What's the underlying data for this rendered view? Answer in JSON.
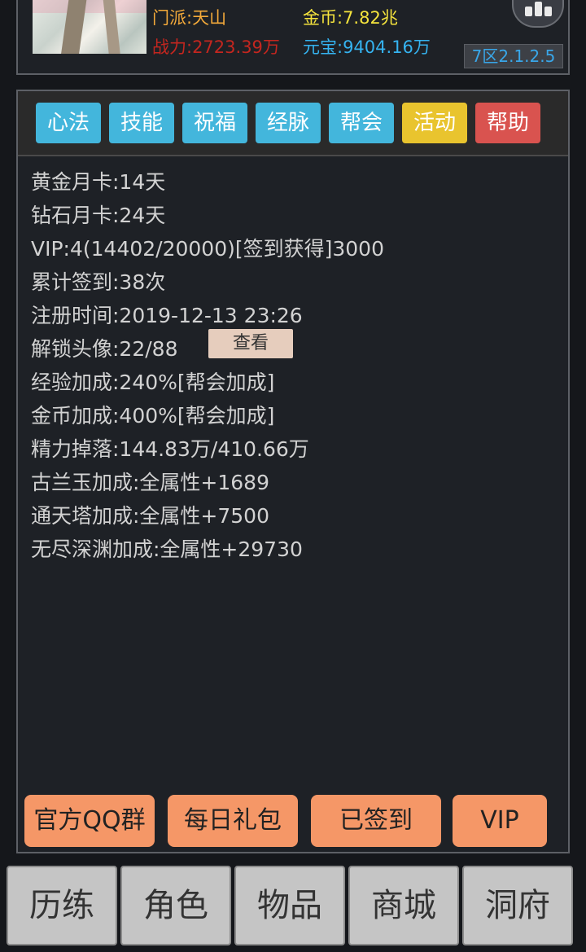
{
  "header": {
    "sect": "门派:天山",
    "gold": "金币:7.82兆",
    "power": "战力:2723.39万",
    "ingot": "元宝:9404.16万",
    "version": "7区2.1.2.5",
    "rank_icon": "bar-chart-icon"
  },
  "tabs": [
    {
      "label": "心法",
      "color": "#43b6dc"
    },
    {
      "label": "技能",
      "color": "#43b6dc"
    },
    {
      "label": "祝福",
      "color": "#43b6dc"
    },
    {
      "label": "经脉",
      "color": "#43b6dc"
    },
    {
      "label": "帮会",
      "color": "#43b6dc"
    },
    {
      "label": "活动",
      "color": "#e9c42e"
    },
    {
      "label": "帮助",
      "color": "#d9534f"
    }
  ],
  "info": {
    "gold_card": "黄金月卡:14天",
    "diamond_card": "钻石月卡:24天",
    "vip": "VIP:4(14402/20000)[签到获得]3000",
    "total_signin": "累计签到:38次",
    "register_time": "注册时间:2019-12-13 23:26",
    "unlock_avatar": "解锁头像:22/88",
    "view_label": "查看",
    "exp_bonus": "经验加成:240%[帮会加成]",
    "gold_bonus": "金币加成:400%[帮会加成]",
    "energy_drop": "精力掉落:144.83万/410.66万",
    "gulan_bonus": "古兰玉加成:全属性+1689",
    "tower_bonus": "通天塔加成:全属性+7500",
    "abyss_bonus": "无尽深渊加成:全属性+29730"
  },
  "actions": {
    "qq_group": "官方QQ群",
    "daily_gift": "每日礼包",
    "signed_in": "已签到",
    "vip": "VIP"
  },
  "nav": [
    {
      "label": "历练"
    },
    {
      "label": "角色"
    },
    {
      "label": "物品"
    },
    {
      "label": "商城"
    },
    {
      "label": "洞府"
    }
  ]
}
